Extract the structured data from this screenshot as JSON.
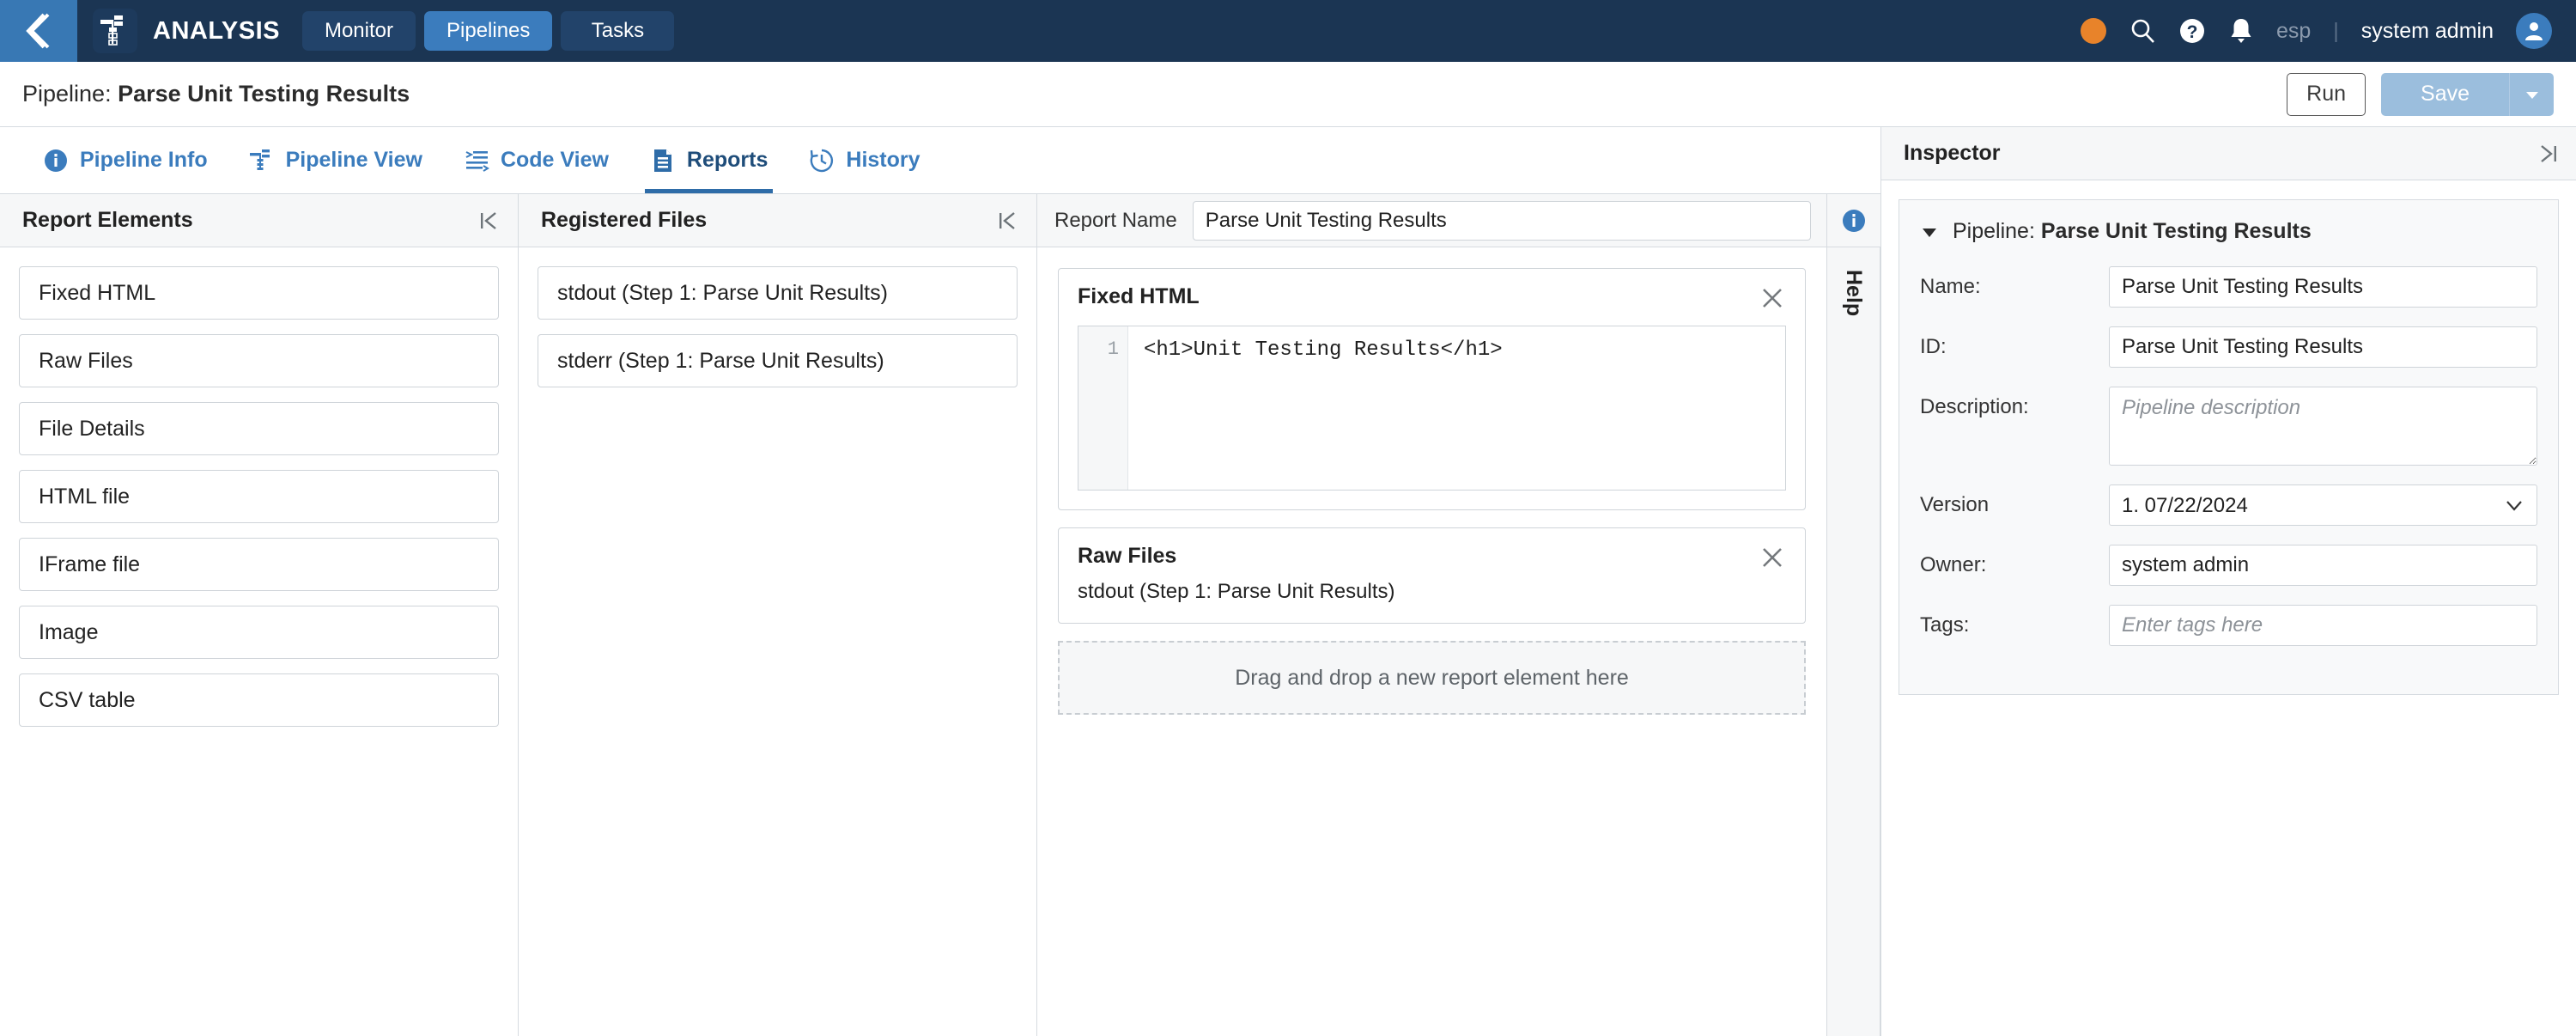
{
  "topbar": {
    "back_icon": "chevron-left-icon",
    "brand": "ANALYSIS",
    "brand_logo_icon": "pipeline-logo-icon",
    "nav": [
      {
        "label": "Monitor",
        "active": false
      },
      {
        "label": "Pipelines",
        "active": true
      },
      {
        "label": "Tasks",
        "active": false
      }
    ],
    "status_dot_color": "#e8832a",
    "search_icon": "search-icon",
    "help_icon": "help-circle-icon",
    "bell_icon": "bell-icon",
    "language": "esp",
    "separator": "|",
    "username": "system admin",
    "avatar_icon": "user-avatar-icon"
  },
  "title_row": {
    "prefix": "Pipeline: ",
    "name": "Parse Unit Testing Results",
    "run_label": "Run",
    "save_label": "Save",
    "save_caret_icon": "caret-down-icon"
  },
  "view_tabs": [
    {
      "label": "Pipeline Info",
      "icon": "info-circle-icon",
      "active": false
    },
    {
      "label": "Pipeline View",
      "icon": "pipeline-tree-icon",
      "active": false
    },
    {
      "label": "Code View",
      "icon": "code-lines-icon",
      "active": false
    },
    {
      "label": "Reports",
      "icon": "report-document-icon",
      "active": true
    },
    {
      "label": "History",
      "icon": "clock-revert-icon",
      "active": false
    }
  ],
  "report_elements": {
    "title": "Report Elements",
    "collapse_icon": "collapse-left-icon",
    "items": [
      {
        "label": "Fixed HTML"
      },
      {
        "label": "Raw Files"
      },
      {
        "label": "File Details"
      },
      {
        "label": "HTML file"
      },
      {
        "label": "IFrame file"
      },
      {
        "label": "Image"
      },
      {
        "label": "CSV table"
      }
    ]
  },
  "registered_files": {
    "title": "Registered Files",
    "collapse_icon": "collapse-left-icon",
    "items": [
      {
        "label": "stdout (Step 1: Parse Unit Results)"
      },
      {
        "label": "stderr (Step 1: Parse Unit Results)"
      }
    ]
  },
  "report": {
    "name_label": "Report Name",
    "name_value": "Parse Unit Testing Results",
    "name_placeholder": "Report Name",
    "cards": [
      {
        "title": "Fixed HTML",
        "close_icon": "close-icon",
        "line_number": "1",
        "code": "<h1>Unit Testing Results</h1>"
      },
      {
        "title": "Raw Files",
        "close_icon": "close-icon",
        "subtitle": "stdout (Step 1: Parse Unit Results)"
      }
    ],
    "dropzone_text": "Drag and drop a new report element here"
  },
  "help_rail": {
    "info_icon": "info-circle-icon",
    "label": "Help"
  },
  "inspector": {
    "title": "Inspector",
    "collapse_icon": "expand-right-icon",
    "card": {
      "caret_icon": "caret-down-icon",
      "prefix": "Pipeline: ",
      "name": "Parse Unit Testing Results",
      "fields": {
        "name_label": "Name:",
        "name_value": "Parse Unit Testing Results",
        "id_label": "ID:",
        "id_value": "Parse Unit Testing Results",
        "description_label": "Description:",
        "description_value": "",
        "description_placeholder": "Pipeline description",
        "version_label": "Version",
        "version_value": "1. 07/22/2024",
        "owner_label": "Owner:",
        "owner_value": "system admin",
        "tags_label": "Tags:",
        "tags_value": "",
        "tags_placeholder": "Enter tags here"
      }
    }
  },
  "colors": {
    "nav_bg": "#1b3553",
    "accent_blue": "#3b7cbd",
    "tab_blue": "#2e6ca8",
    "orange": "#e8832a",
    "save_blue": "#9bbedd",
    "panel_bg": "#f6f7f8",
    "border": "#d6dbe0"
  }
}
